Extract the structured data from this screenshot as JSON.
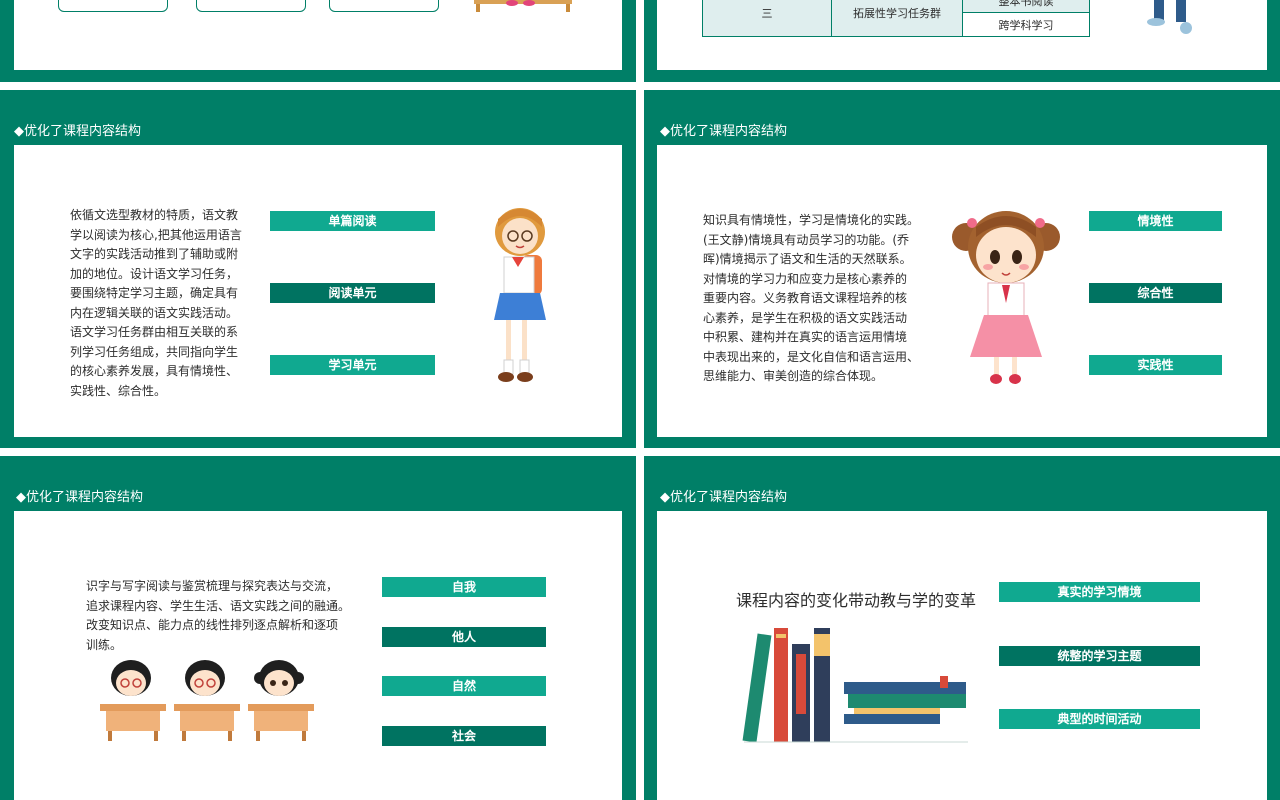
{
  "colors": {
    "green": "#007f67",
    "light_bar": "#10a990",
    "dark_bar": "#007361",
    "text": "#2d2d2d"
  },
  "top_table": {
    "row_label": "三",
    "group_label": "拓展性学习任务群",
    "items": [
      "整本书阅读",
      "跨学科学习"
    ]
  },
  "slides": [
    {
      "title": "◆优化了课程内容结构",
      "paragraph": "依循文选型教材的特质，语文教\n学以阅读为核心,把其他运用语言\n文字的实践活动推到了辅助或附\n加的地位。设计语文学习任务，\n要围绕特定学习主题，确定具有\n内在逻辑关联的语文实践活动。\n语文学习任务群由相互关联的系\n列学习任务组成，共同指向学生\n的核心素养发展，具有情境性、\n实践性、综合性。",
      "bars": [
        "单篇阅读",
        "阅读单元",
        "学习单元"
      ]
    },
    {
      "title": "◆优化了课程内容结构",
      "paragraph": "知识具有情境性，学习是情境化的实践。\n(王文静)情境具有动员学习的功能。(乔\n晖)情境揭示了语文和生活的天然联系。\n对情境的学习力和应变力是核心素养的\n重要内容。义务教育语文课程培养的核\n心素养，是学生在积极的语文实践活动\n中积累、建构并在真实的语言运用情境\n中表现出来的，是文化自信和语言运用、\n思维能力、审美创造的综合体现。",
      "bars": [
        "情境性",
        "综合性",
        "实践性"
      ]
    },
    {
      "title": "◆优化了课程内容结构",
      "paragraph": "识字与写字阅读与鉴赏梳理与探究表达与交流，\n追求课程内容、学生生活、语文实践之间的融通。\n改变知识点、能力点的线性排列逐点解析和逐项\n训练。",
      "bars": [
        "自我",
        "他人",
        "自然",
        "社会"
      ]
    },
    {
      "title": "◆优化了课程内容结构",
      "heading": "课程内容的变化带动教与学的变革",
      "bars": [
        "真实的学习情境",
        "统整的学习主题",
        "典型的时间活动"
      ]
    }
  ]
}
